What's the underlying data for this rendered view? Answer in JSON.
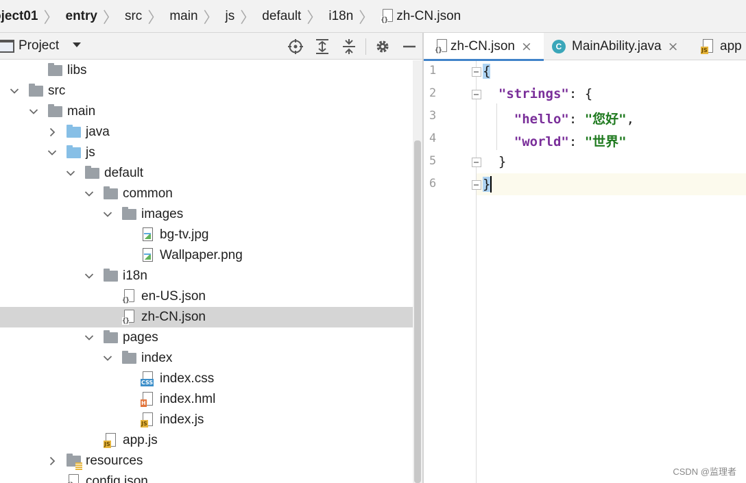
{
  "breadcrumb": {
    "items": [
      "oject01",
      "entry",
      "src",
      "main",
      "js",
      "default",
      "i18n",
      "zh-CN.json"
    ],
    "separator": "〉"
  },
  "project_panel": {
    "title": "Project",
    "dropdown_icon": "caret-down-icon",
    "actions": [
      "locate-icon",
      "expand-all-icon",
      "collapse-all-icon",
      "gear-icon",
      "minimize-icon"
    ]
  },
  "tree": [
    {
      "label": "libs",
      "icon": "folder-icon",
      "arrow": ""
    },
    {
      "label": "src",
      "icon": "folder-icon",
      "arrow": "expanded"
    },
    {
      "label": "main",
      "icon": "folder-icon",
      "arrow": "expanded"
    },
    {
      "label": "java",
      "icon": "source-folder-icon",
      "arrow": "collapsed"
    },
    {
      "label": "js",
      "icon": "source-folder-icon",
      "arrow": "expanded"
    },
    {
      "label": "default",
      "icon": "folder-icon",
      "arrow": "expanded"
    },
    {
      "label": "common",
      "icon": "folder-icon",
      "arrow": "expanded"
    },
    {
      "label": "images",
      "icon": "folder-icon",
      "arrow": "expanded"
    },
    {
      "label": "bg-tv.jpg",
      "icon": "image-file-icon",
      "arrow": ""
    },
    {
      "label": "Wallpaper.png",
      "icon": "image-file-icon",
      "arrow": ""
    },
    {
      "label": "i18n",
      "icon": "folder-icon",
      "arrow": "expanded"
    },
    {
      "label": "en-US.json",
      "icon": "json-file-icon",
      "arrow": ""
    },
    {
      "label": "zh-CN.json",
      "icon": "json-file-icon",
      "arrow": "",
      "selected": true
    },
    {
      "label": "pages",
      "icon": "folder-icon",
      "arrow": "expanded"
    },
    {
      "label": "index",
      "icon": "folder-icon",
      "arrow": "expanded"
    },
    {
      "label": "index.css",
      "icon": "css-file-icon",
      "arrow": "",
      "tag": "CSS"
    },
    {
      "label": "index.hml",
      "icon": "html-file-icon",
      "arrow": "",
      "tag": "H"
    },
    {
      "label": "index.js",
      "icon": "js-file-icon",
      "arrow": "",
      "tag": "JS"
    },
    {
      "label": "app.js",
      "icon": "js-file-icon",
      "arrow": "",
      "tag": "JS"
    },
    {
      "label": "resources",
      "icon": "resources-folder-icon",
      "arrow": "collapsed"
    },
    {
      "label": "config.json",
      "icon": "json-file-icon",
      "arrow": ""
    }
  ],
  "tabs": [
    {
      "label": "zh-CN.json",
      "icon": "json-file-icon",
      "active": true,
      "close": "×"
    },
    {
      "label": "MainAbility.java",
      "icon": "class-icon",
      "icon_text": "C",
      "active": false,
      "close": "×"
    },
    {
      "label": "app",
      "icon": "js-file-icon",
      "active": false
    }
  ],
  "editor": {
    "line_numbers": [
      "1",
      "2",
      "3",
      "4",
      "5",
      "6"
    ],
    "lines": [
      [
        {
          "t": "{",
          "c": "p hl"
        }
      ],
      [
        {
          "t": "  ",
          "c": "p"
        },
        {
          "t": "\"strings\"",
          "c": "k"
        },
        {
          "t": ": {",
          "c": "p"
        }
      ],
      [
        {
          "t": "    ",
          "c": "p"
        },
        {
          "t": "\"hello\"",
          "c": "k"
        },
        {
          "t": ": ",
          "c": "p"
        },
        {
          "t": "\"您好\"",
          "c": "s"
        },
        {
          "t": ",",
          "c": "p"
        }
      ],
      [
        {
          "t": "    ",
          "c": "p"
        },
        {
          "t": "\"world\"",
          "c": "k"
        },
        {
          "t": ": ",
          "c": "p"
        },
        {
          "t": "\"世界\"",
          "c": "s"
        }
      ],
      [
        {
          "t": "  }",
          "c": "p"
        }
      ],
      [
        {
          "t": "}",
          "c": "p hl"
        }
      ]
    ],
    "current_line": 6
  },
  "watermark": "CSDN @监理者",
  "colors": {
    "selection": "#d5d5d5",
    "tab_underline": "#4083c9",
    "json_key": "#7a2f9a",
    "json_string": "#1f7a1f",
    "current_line": "#fcfaed"
  }
}
